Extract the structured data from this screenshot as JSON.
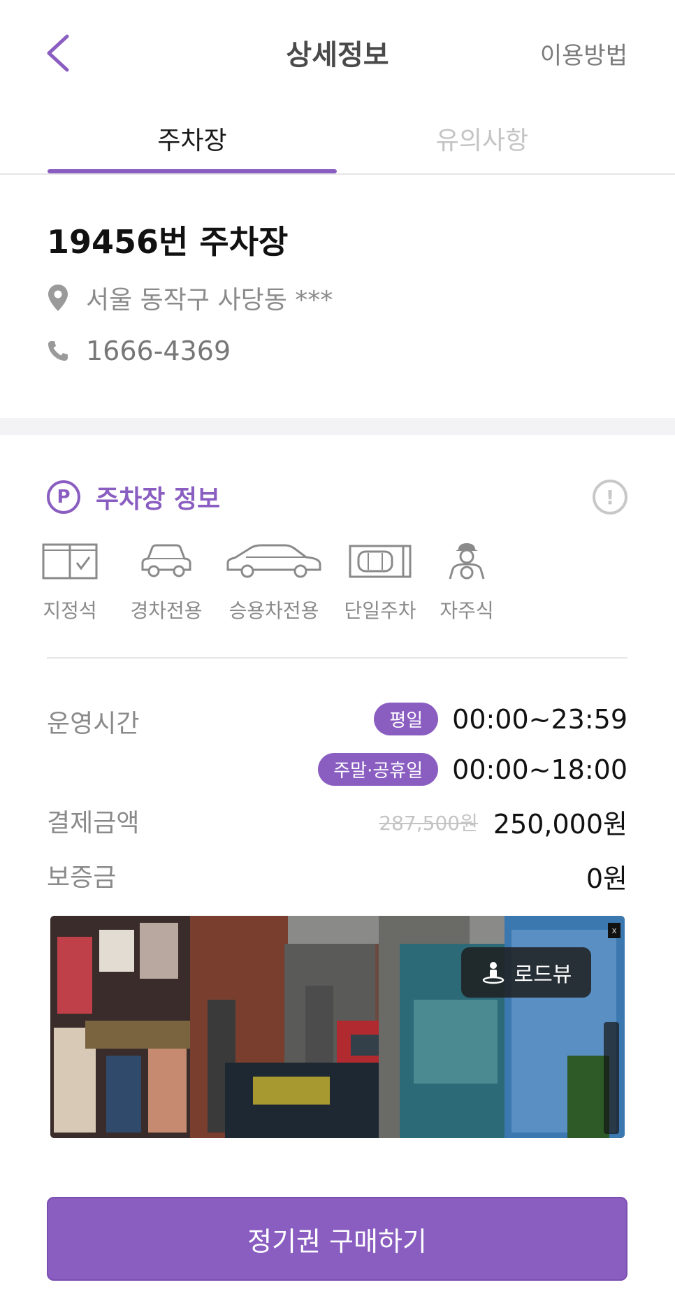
{
  "header": {
    "title": "상세정보",
    "help_label": "이용방법"
  },
  "tabs": [
    {
      "label": "주차장",
      "active": true
    },
    {
      "label": "유의사항",
      "active": false
    }
  ],
  "lot": {
    "name": "19456번 주차장",
    "address": "서울 동작구 사당동 ***",
    "phone": "1666-4369"
  },
  "section": {
    "title": "주차장 정보",
    "badge": "P",
    "alert_glyph": "!"
  },
  "features": [
    {
      "icon": "reserved-seat-icon",
      "label": "지정석"
    },
    {
      "icon": "compact-car-icon",
      "label": "경차전용"
    },
    {
      "icon": "sedan-icon",
      "label": "승용차전용"
    },
    {
      "icon": "single-parking-icon",
      "label": "단일주차"
    },
    {
      "icon": "self-parking-icon",
      "label": "자주식"
    }
  ],
  "details": {
    "hours_label": "운영시간",
    "weekday_badge": "평일",
    "weekday_hours": "00:00~23:59",
    "weekend_badge": "주말·공휴일",
    "weekend_hours": "00:00~18:00",
    "price_label": "결제금액",
    "original_price": "287,500원",
    "price": "250,000원",
    "deposit_label": "보증금",
    "deposit": "0원"
  },
  "roadview": {
    "label": "로드뷰",
    "close_glyph": "x"
  },
  "cta": {
    "label": "정기권 구매하기"
  },
  "colors": {
    "accent": "#8a5dc1",
    "muted": "#8a8a8a",
    "divider": "#e6e6e6"
  }
}
